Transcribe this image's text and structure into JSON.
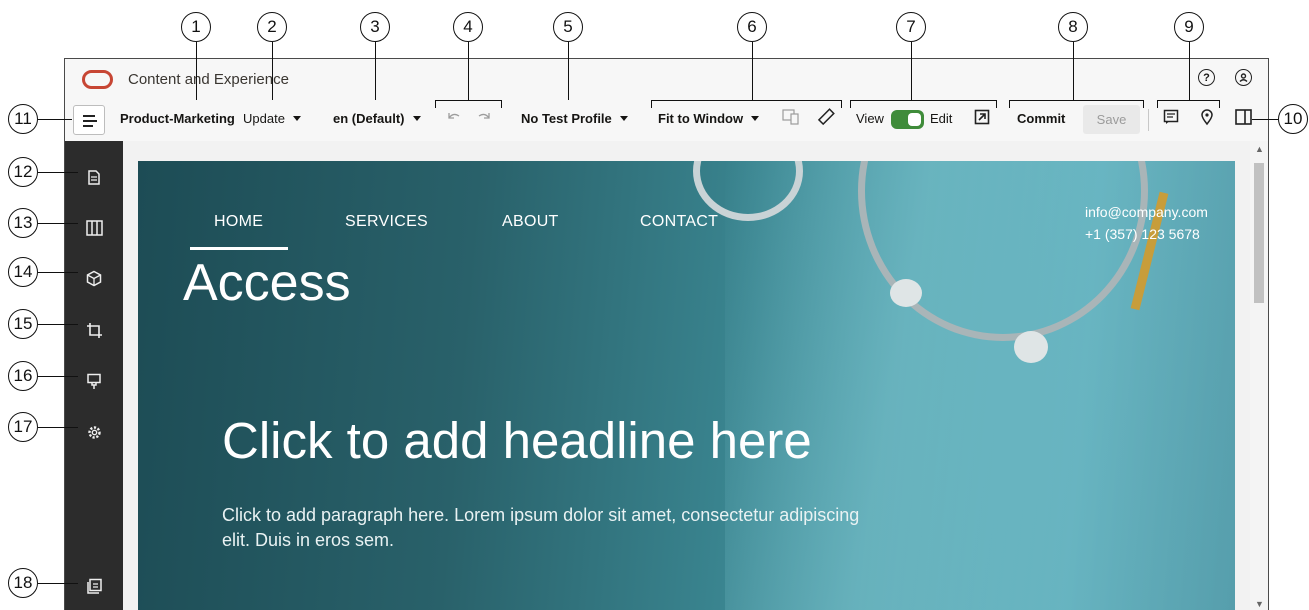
{
  "header": {
    "app_title": "Content and Experience",
    "help_icon": "help-icon",
    "user_icon": "user-icon"
  },
  "toolbar": {
    "site_name": "Product-Marketing",
    "update_label": "Update",
    "language_label": "en (Default)",
    "test_profile_label": "No Test Profile",
    "fit_label": "Fit to Window",
    "view_label": "View",
    "edit_label": "Edit",
    "commit_label": "Commit",
    "save_label": "Save"
  },
  "callouts": [
    "1",
    "2",
    "3",
    "4",
    "5",
    "6",
    "7",
    "8",
    "9",
    "10",
    "11",
    "12",
    "13",
    "14",
    "15",
    "16",
    "17",
    "18"
  ],
  "page": {
    "nav": [
      "HOME",
      "SERVICES",
      "ABOUT",
      "CONTACT"
    ],
    "title": "Access",
    "headline": "Click to add headline here",
    "paragraph": "Click to add paragraph here. Lorem ipsum dolor sit amet, consectetur adipiscing elit. Duis in eros sem.",
    "email": "info@company.com",
    "phone": "+1 (357) 123 5678"
  },
  "colors": {
    "brand": "#c74634",
    "toggle_on": "#3f8c3a",
    "rail": "#2c2c2c"
  }
}
